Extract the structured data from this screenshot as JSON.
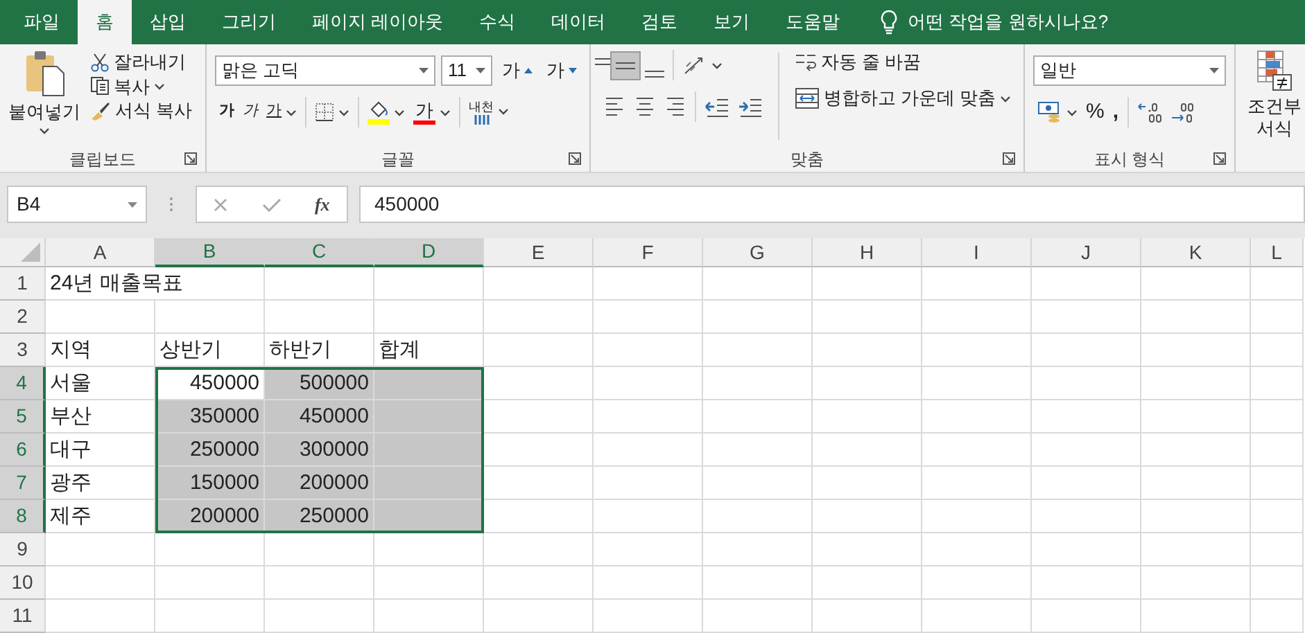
{
  "tabs": [
    {
      "label": "파일",
      "selected": false
    },
    {
      "label": "홈",
      "selected": true
    },
    {
      "label": "삽입",
      "selected": false
    },
    {
      "label": "그리기",
      "selected": false
    },
    {
      "label": "페이지 레이아웃",
      "selected": false
    },
    {
      "label": "수식",
      "selected": false
    },
    {
      "label": "데이터",
      "selected": false
    },
    {
      "label": "검토",
      "selected": false
    },
    {
      "label": "보기",
      "selected": false
    },
    {
      "label": "도움말",
      "selected": false
    }
  ],
  "tell_me": "어떤 작업을 원하시나요?",
  "clipboard": {
    "paste": "붙여넣기",
    "cut": "잘라내기",
    "copy": "복사",
    "format_painter": "서식 복사",
    "label": "클립보드"
  },
  "font": {
    "font_name": "맑은 고딕",
    "font_size": "11",
    "grow": "가",
    "shrink": "가",
    "bold": "가",
    "italic": "가",
    "underline": "가",
    "font_color": "가",
    "phonetic": "내천",
    "label": "글꼴"
  },
  "alignment": {
    "vertical": [
      {
        "selected": false
      },
      {
        "selected": true
      },
      {
        "selected": false
      }
    ],
    "wrap_text": "자동 줄 바꿈",
    "merge_center": "병합하고 가운데 맞춤",
    "label": "맞춤"
  },
  "number": {
    "format": "일반",
    "percent": "%",
    "comma": ",",
    "label": "표시 형식"
  },
  "styles": {
    "conditional_formatting": "조건부 서식"
  },
  "formula_bar": {
    "name_box": "B4",
    "fx": "fx",
    "value": "450000"
  },
  "sheet": {
    "columns": [
      {
        "label": "A",
        "selected": false
      },
      {
        "label": "B",
        "selected": true
      },
      {
        "label": "C",
        "selected": true
      },
      {
        "label": "D",
        "selected": true
      },
      {
        "label": "E",
        "selected": false
      },
      {
        "label": "F",
        "selected": false
      },
      {
        "label": "G",
        "selected": false
      },
      {
        "label": "H",
        "selected": false
      },
      {
        "label": "I",
        "selected": false
      },
      {
        "label": "J",
        "selected": false
      },
      {
        "label": "K",
        "selected": false
      },
      {
        "label": "L",
        "selected": false
      }
    ],
    "rows": [
      {
        "label": "1",
        "selected": false,
        "cells": [
          {
            "kind": "text",
            "text": "24년 매출목표",
            "selected": false
          }
        ]
      },
      {
        "label": "2",
        "selected": false
      },
      {
        "label": "3",
        "selected": false,
        "cells": [
          {
            "kind": "text",
            "text": "지역",
            "selected": false
          },
          {
            "kind": "text",
            "text": "상반기",
            "selected": false
          },
          {
            "kind": "text",
            "text": "하반기",
            "selected": false
          },
          {
            "kind": "text",
            "text": "합계",
            "selected": false
          }
        ]
      },
      {
        "label": "4",
        "selected": true,
        "cells": [
          {
            "kind": "text",
            "text": "서울",
            "selected": false
          },
          {
            "kind": "number",
            "text": "450000",
            "selected": true,
            "active": true
          },
          {
            "kind": "number",
            "text": "500000",
            "selected": true,
            "active": false
          },
          {
            "kind": "empty",
            "selected": true,
            "active": false
          }
        ]
      },
      {
        "label": "5",
        "selected": true,
        "cells": [
          {
            "kind": "text",
            "text": "부산",
            "selected": false
          },
          {
            "kind": "number",
            "text": "350000",
            "selected": true,
            "active": false
          },
          {
            "kind": "number",
            "text": "450000",
            "selected": true,
            "active": false
          },
          {
            "kind": "empty",
            "selected": true,
            "active": false
          }
        ]
      },
      {
        "label": "6",
        "selected": true,
        "cells": [
          {
            "kind": "text",
            "text": "대구",
            "selected": false
          },
          {
            "kind": "number",
            "text": "250000",
            "selected": true,
            "active": false
          },
          {
            "kind": "number",
            "text": "300000",
            "selected": true,
            "active": false
          },
          {
            "kind": "empty",
            "selected": true,
            "active": false
          }
        ]
      },
      {
        "label": "7",
        "selected": true,
        "cells": [
          {
            "kind": "text",
            "text": "광주",
            "selected": false
          },
          {
            "kind": "number",
            "text": "150000",
            "selected": true,
            "active": false
          },
          {
            "kind": "number",
            "text": "200000",
            "selected": true,
            "active": false
          },
          {
            "kind": "empty",
            "selected": true,
            "active": false
          }
        ]
      },
      {
        "label": "8",
        "selected": true,
        "cells": [
          {
            "kind": "text",
            "text": "제주",
            "selected": false
          },
          {
            "kind": "number",
            "text": "200000",
            "selected": true,
            "active": false
          },
          {
            "kind": "number",
            "text": "250000",
            "selected": true,
            "active": false
          },
          {
            "kind": "empty",
            "selected": true,
            "active": false
          }
        ]
      },
      {
        "label": "9",
        "selected": false
      },
      {
        "label": "10",
        "selected": false
      },
      {
        "label": "11",
        "selected": false
      }
    ]
  }
}
